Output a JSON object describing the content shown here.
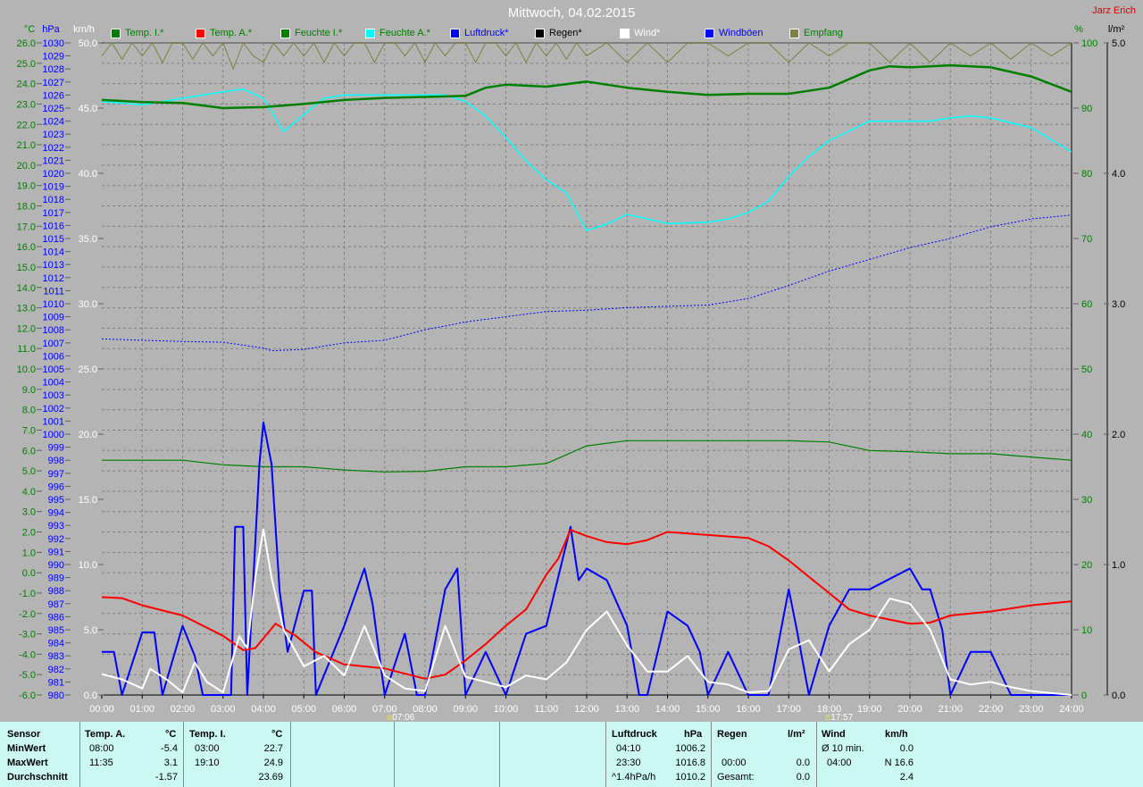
{
  "header": {
    "title": "Mittwoch, 04.02.2015",
    "author": "Jarz Erich"
  },
  "legend": [
    {
      "label": "Temp. I.*",
      "color": "#008000"
    },
    {
      "label": "Temp. A.*",
      "color": "#ff0000"
    },
    {
      "label": "Feuchte I.*",
      "color": "#008000"
    },
    {
      "label": "Feuchte A.*",
      "color": "#00ffff"
    },
    {
      "label": "Luftdruck*",
      "color": "#0000ff"
    },
    {
      "label": "Regen*",
      "color": "#000000"
    },
    {
      "label": "Wind*",
      "color": "#ffffff"
    },
    {
      "label": "Windböen",
      "color": "#0000ff"
    },
    {
      "label": "Empfang",
      "color": "#808040"
    }
  ],
  "chart_data": {
    "type": "line",
    "title": "Mittwoch, 04.02.2015",
    "xlabel": "",
    "x_ticks": [
      "00:00",
      "01:00",
      "02:00",
      "03:00",
      "04:00",
      "05:00",
      "06:00",
      "07:00",
      "08:00",
      "09:00",
      "10:00",
      "11:00",
      "12:00",
      "13:00",
      "14:00",
      "15:00",
      "16:00",
      "17:00",
      "18:00",
      "19:00",
      "20:00",
      "21:00",
      "22:00",
      "23:00",
      "24:00"
    ],
    "xlim": [
      0,
      24
    ],
    "axes": {
      "temp": {
        "unit": "°C",
        "range": [
          -6,
          26
        ],
        "step": 1,
        "decimals": 1,
        "color": "#008000"
      },
      "pressure": {
        "unit": "hPa",
        "range": [
          980,
          1030
        ],
        "step": 1,
        "decimals": 0,
        "color": "#0000ff"
      },
      "wind": {
        "unit": "km/h",
        "range": [
          0,
          50
        ],
        "step": 5,
        "decimals": 1,
        "color": "#ffffff"
      },
      "humidity": {
        "unit": "%",
        "range": [
          0,
          100
        ],
        "step": 10,
        "decimals": 0,
        "color": "#008000"
      },
      "rain": {
        "unit": "l/m²",
        "range": [
          0,
          5
        ],
        "step": 1,
        "decimals": 1,
        "color": "#000000"
      }
    },
    "grid": true,
    "markers": [
      {
        "label": "07:06",
        "x": 7.1
      },
      {
        "label": "17:57",
        "x": 17.95
      }
    ],
    "series": [
      {
        "name": "Temp. I.*",
        "axis": "temp",
        "color": "#008000",
        "width": 2.5,
        "x": [
          0,
          1,
          2,
          3,
          4,
          5,
          6,
          7,
          8,
          9,
          9.5,
          10,
          11,
          12,
          13,
          14,
          15,
          16,
          17,
          18,
          19,
          19.5,
          20,
          21,
          22,
          23,
          24
        ],
        "y": [
          23.2,
          23.1,
          23.05,
          22.8,
          22.85,
          23.0,
          23.2,
          23.3,
          23.35,
          23.4,
          23.8,
          23.95,
          23.85,
          24.1,
          23.8,
          23.6,
          23.45,
          23.5,
          23.5,
          23.8,
          24.65,
          24.85,
          24.8,
          24.9,
          24.8,
          24.35,
          23.6
        ]
      },
      {
        "name": "Temp. A.*",
        "axis": "temp",
        "color": "#ff0000",
        "width": 2,
        "x": [
          0,
          0.5,
          1,
          2,
          2.5,
          3,
          3.5,
          3.8,
          4.3,
          4.8,
          5.3,
          6,
          7,
          8,
          8.5,
          9,
          9.5,
          10,
          10.5,
          11,
          11.3,
          11.6,
          12,
          12.5,
          13,
          13.5,
          14,
          15,
          16,
          16.5,
          17,
          17.5,
          18,
          18.5,
          19,
          19.5,
          20,
          20.5,
          21,
          22,
          23,
          24
        ],
        "y": [
          -1.2,
          -1.25,
          -1.6,
          -2.1,
          -2.6,
          -3.1,
          -3.8,
          -3.7,
          -2.5,
          -3.1,
          -3.9,
          -4.5,
          -4.7,
          -5.2,
          -5.0,
          -4.3,
          -3.5,
          -2.6,
          -1.8,
          -0.1,
          0.7,
          2.1,
          1.8,
          1.5,
          1.4,
          1.6,
          2.0,
          1.85,
          1.7,
          1.3,
          0.6,
          -0.2,
          -1.0,
          -1.8,
          -2.1,
          -2.3,
          -2.5,
          -2.45,
          -2.1,
          -1.9,
          -1.6,
          -1.4
        ]
      },
      {
        "name": "Feuchte I.*",
        "axis": "humidity",
        "color": "#008000",
        "width": 1.2,
        "x": [
          0,
          2,
          3,
          4,
          5,
          6,
          7,
          8,
          9,
          10,
          11,
          12,
          13,
          14,
          15,
          16,
          17,
          18,
          19,
          20,
          21,
          22,
          23,
          24
        ],
        "y": [
          36,
          36,
          35.3,
          35,
          35,
          34.5,
          34.2,
          34.3,
          35,
          35,
          35.5,
          38.2,
          39,
          39,
          39,
          39,
          39,
          38.8,
          37.5,
          37.3,
          37,
          37,
          36.5,
          36
        ]
      },
      {
        "name": "Feuchte A.*",
        "axis": "humidity",
        "color": "#00ffff",
        "width": 1.5,
        "x": [
          0,
          1,
          2,
          3,
          3.5,
          4,
          4.5,
          5,
          5.5,
          6,
          7,
          8,
          8.5,
          9,
          9.5,
          10,
          10.5,
          11,
          11.5,
          12,
          12.5,
          13,
          14,
          15,
          15.5,
          16,
          16.5,
          17,
          17.5,
          18,
          19,
          20,
          20.5,
          21,
          21.5,
          22,
          23,
          24
        ],
        "y": [
          91,
          90.5,
          91.5,
          92.5,
          92.9,
          91.5,
          86.4,
          89,
          91.5,
          92,
          92,
          92,
          92,
          91,
          88.8,
          85.5,
          81.9,
          79,
          77,
          71.2,
          72.2,
          73.7,
          72.3,
          72.5,
          73,
          74,
          75.7,
          79.5,
          82.6,
          85,
          88,
          88,
          88,
          88.5,
          88.8,
          88.5,
          87,
          83.3
        ]
      },
      {
        "name": "Luftdruck*",
        "axis": "pressure",
        "color": "#0000ff",
        "width": 1,
        "dash": "2,2",
        "x": [
          0,
          1,
          2,
          3,
          4,
          4.2,
          5,
          6,
          7,
          8,
          9,
          10,
          11,
          12,
          13,
          14,
          15,
          16,
          17,
          18,
          19,
          20,
          21,
          22,
          23,
          24
        ],
        "y": [
          1007.3,
          1007.2,
          1007.1,
          1007.05,
          1006.6,
          1006.4,
          1006.5,
          1007.0,
          1007.2,
          1008.0,
          1008.6,
          1009.0,
          1009.4,
          1009.5,
          1009.7,
          1009.8,
          1009.9,
          1010.4,
          1011.4,
          1012.5,
          1013.4,
          1014.3,
          1015.0,
          1015.9,
          1016.5,
          1016.8
        ]
      },
      {
        "name": "Windböen",
        "axis": "wind",
        "color": "#0000ff",
        "width": 2,
        "x": [
          0,
          0.3,
          0.5,
          1,
          1.3,
          1.5,
          2,
          2.3,
          2.5,
          3.2,
          3.3,
          3.5,
          3.6,
          3.9,
          4.0,
          4.2,
          4.4,
          4.6,
          5,
          5.2,
          5.3,
          6,
          6.5,
          6.7,
          7,
          7.5,
          7.8,
          8,
          8.5,
          8.8,
          9,
          9.5,
          10,
          10.5,
          11,
          11.6,
          11.8,
          12,
          12.5,
          13,
          13.3,
          13.5,
          14,
          14.5,
          14.8,
          15,
          15.5,
          16,
          16.5,
          17,
          17.2,
          17.5,
          18,
          18.5,
          19,
          20,
          20.3,
          20.5,
          20.8,
          21,
          21.5,
          22,
          22.5,
          23,
          24
        ],
        "y": [
          3.3,
          3.3,
          0,
          4.8,
          4.8,
          0,
          5.3,
          3,
          0,
          0,
          12.9,
          12.9,
          0,
          17.7,
          20.9,
          17.7,
          8,
          3.3,
          8,
          8,
          0,
          5.3,
          9.7,
          7,
          0,
          4.7,
          0,
          0,
          8.1,
          9.7,
          0,
          3.3,
          0,
          4.7,
          5.3,
          12.9,
          8.8,
          9.7,
          8.8,
          5.3,
          0,
          0,
          6.4,
          5.3,
          3.3,
          0,
          3.3,
          0,
          0,
          8.1,
          5,
          0,
          5.3,
          8.1,
          8.1,
          9.7,
          8.1,
          8.1,
          5,
          0,
          3.3,
          3.3,
          0,
          0,
          0
        ]
      },
      {
        "name": "Wind*",
        "axis": "wind",
        "color": "#ffffff",
        "width": 2,
        "x": [
          0,
          0.5,
          1,
          1.2,
          1.6,
          2,
          2.3,
          2.6,
          3,
          3.4,
          3.6,
          3.8,
          4.0,
          4.2,
          4.5,
          5,
          5.5,
          6,
          6.5,
          7,
          7.5,
          8,
          8.5,
          9,
          9.5,
          10,
          10.5,
          11,
          11.5,
          12,
          12.5,
          13,
          13.5,
          14,
          14.5,
          15,
          15.5,
          16,
          16.5,
          17,
          17.5,
          18,
          18.5,
          19,
          19.5,
          20,
          20.5,
          21,
          21.5,
          22,
          22.5,
          23,
          24
        ],
        "y": [
          1.6,
          1.2,
          0.5,
          2,
          1.2,
          0.2,
          2.5,
          1,
          0.2,
          4.5,
          3.6,
          9,
          12.7,
          9,
          5,
          2.2,
          3,
          1.5,
          5.3,
          1.5,
          0.5,
          0.3,
          5.3,
          1.4,
          1,
          0.6,
          1.5,
          1.2,
          2.5,
          5,
          6.4,
          3.8,
          1.8,
          1.8,
          3,
          1,
          0.8,
          0.2,
          0.3,
          3.5,
          4.2,
          1.8,
          3.9,
          5,
          7.4,
          7,
          5,
          1.2,
          0.8,
          1,
          0.6,
          0.3,
          0
        ]
      },
      {
        "name": "Empfang",
        "axis": "humidity",
        "color": "#808040",
        "width": 1,
        "x": [
          0,
          0.25,
          0.5,
          0.75,
          1,
          1.25,
          1.5,
          1.75,
          2,
          2.25,
          2.5,
          2.75,
          3,
          3.25,
          3.5,
          3.75,
          4,
          4.25,
          4.5,
          4.75,
          5,
          5.25,
          5.5,
          5.75,
          6,
          6.25,
          6.5,
          6.75,
          7,
          7.25,
          7.5,
          7.75,
          8,
          8.25,
          8.5,
          8.75,
          9,
          9.25,
          9.5,
          9.75,
          10,
          10.25,
          10.5,
          10.75,
          11,
          11.25,
          11.5,
          11.75,
          12,
          12.5,
          13,
          13.5,
          14,
          14.5,
          15,
          15.5,
          16,
          16.5,
          17,
          17.5,
          18,
          18.5,
          19,
          19.5,
          20,
          20.5,
          21,
          21.5,
          22,
          22.5,
          23,
          23.5,
          24
        ],
        "y": [
          98,
          100,
          97.5,
          100,
          98,
          100,
          97,
          100,
          100,
          97.5,
          100,
          98,
          100,
          96,
          100,
          98,
          97,
          100,
          98,
          100,
          98,
          100,
          97,
          100,
          98,
          100,
          100,
          97,
          100,
          100,
          98,
          100,
          97,
          100,
          98,
          100,
          100,
          97,
          100,
          100,
          98,
          100,
          97,
          100,
          98,
          100,
          97.5,
          100,
          98,
          100,
          97,
          100,
          97,
          100,
          100,
          98,
          100,
          100,
          97,
          100,
          98,
          100,
          100,
          97,
          100,
          97,
          100,
          98,
          100,
          97.5,
          100,
          98,
          100
        ]
      }
    ]
  },
  "table": {
    "sensor": {
      "header": "Sensor",
      "rows": [
        "MinWert",
        "MaxWert",
        "Durchschnitt"
      ]
    },
    "temp_a": {
      "header": "Temp. A.",
      "unit": "°C",
      "min_time": "08:00",
      "min": "-5.4",
      "max_time": "11:35",
      "max": "3.1",
      "avg": "-1.57"
    },
    "temp_i": {
      "header": "Temp. I.",
      "unit": "°C",
      "min_time": "03:00",
      "min": "22.7",
      "max_time": "19:10",
      "max": "24.9",
      "avg": "23.69"
    },
    "pressure": {
      "header": "Luftdruck",
      "unit": "hPa",
      "min_time": "04:10",
      "min": "1006.2",
      "max_time": "23:30",
      "max": "1016.8",
      "trend": "^1.4hPa/h",
      "avg": "1010.2"
    },
    "rain": {
      "header": "Regen",
      "unit": "l/m²",
      "time": "00:00",
      "value": "0.0",
      "total_label": "Gesamt:",
      "total": "0.0"
    },
    "wind": {
      "header": "Wind",
      "unit": "km/h",
      "avg10_label": "Ø 10 min.",
      "avg10": "0.0",
      "max_time": "04:00",
      "max": "N 16.6",
      "avg": "2.4"
    }
  }
}
